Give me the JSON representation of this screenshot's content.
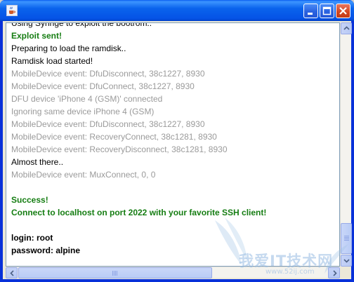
{
  "window": {
    "title": "",
    "frame_color": "#0831d9",
    "icons": {
      "app": "java-cup-icon",
      "minimize": "minimize-icon",
      "maximize": "maximize-icon",
      "close": "close-icon"
    }
  },
  "log": {
    "lines": [
      {
        "text": "Using Syringe to exploit the bootrom..",
        "style": "black"
      },
      {
        "text": "Exploit sent!",
        "style": "green"
      },
      {
        "text": "Preparing to load the ramdisk..",
        "style": "black"
      },
      {
        "text": "Ramdisk load started!",
        "style": "black"
      },
      {
        "text": "MobileDevice event: DfuDisconnect, 38c1227, 8930",
        "style": "gray"
      },
      {
        "text": "MobileDevice event: DfuConnect, 38c1227, 8930",
        "style": "gray"
      },
      {
        "text": "DFU device 'iPhone 4 (GSM)' connected",
        "style": "gray"
      },
      {
        "text": "Ignoring same device iPhone 4 (GSM)",
        "style": "gray"
      },
      {
        "text": "MobileDevice event: DfuDisconnect, 38c1227, 8930",
        "style": "gray"
      },
      {
        "text": "MobileDevice event: RecoveryConnect, 38c1281, 8930",
        "style": "gray"
      },
      {
        "text": "MobileDevice event: RecoveryDisconnect, 38c1281, 8930",
        "style": "gray"
      },
      {
        "text": "Almost there..",
        "style": "black"
      },
      {
        "text": "MobileDevice event: MuxConnect, 0, 0",
        "style": "gray"
      },
      {
        "text": "",
        "style": "blank"
      },
      {
        "text": "Success!",
        "style": "green"
      },
      {
        "text": "Connect to localhost on port 2022 with your favorite SSH client!",
        "style": "green"
      },
      {
        "text": "",
        "style": "blank"
      },
      {
        "text": "login: root",
        "style": "bold"
      },
      {
        "text": "password: alpine",
        "style": "bold"
      }
    ]
  },
  "scrollbars": {
    "vertical_position": 0.92,
    "horizontal_position": 0.0
  },
  "watermark": {
    "text": "我爱IT技术网",
    "url": "www.52ij.com"
  }
}
